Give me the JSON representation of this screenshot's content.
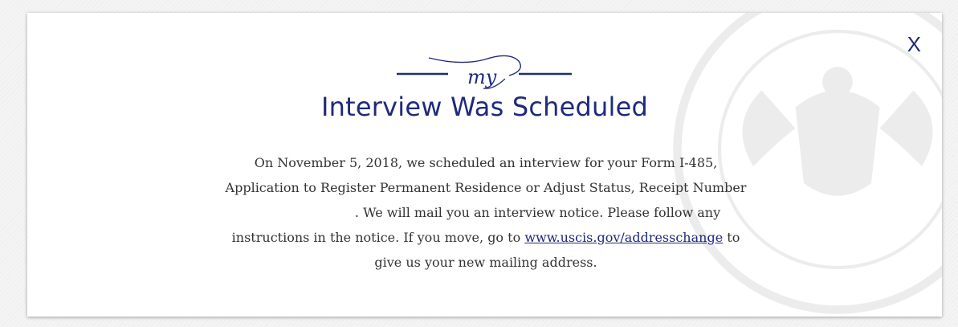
{
  "close": {
    "label": "X"
  },
  "logo": {
    "text": "my"
  },
  "dialog": {
    "title": "Interview Was Scheduled",
    "line1": "On November 5, 2018, we scheduled an interview for your Form I-485, Application to Register Permanent Residence or Adjust Status, Receipt Number",
    "line2": ". We will mail you an interview notice. Please follow any instructions in the notice. If you move, go to",
    "link": "www.uscis.gov/addresschange",
    "line3": "to give us your new mailing address."
  },
  "colors": {
    "accent": "#1f2a7a",
    "text": "#333333",
    "background": "#f4f4f4",
    "modal": "#ffffff"
  },
  "watermark": {
    "icon": "dhs-seal-icon"
  }
}
